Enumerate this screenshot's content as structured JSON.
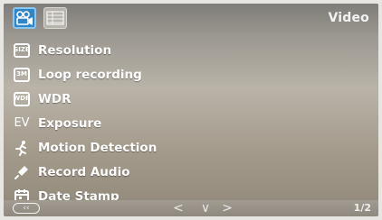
{
  "header": {
    "mode_label": "Video",
    "tabs": [
      {
        "name": "video-tab",
        "icon": "video-camera-icon",
        "active": true
      },
      {
        "name": "settings-tab",
        "icon": "menu-grid-icon",
        "active": false
      }
    ]
  },
  "menu": {
    "items": [
      {
        "label": "Resolution",
        "icon": "size-icon",
        "icon_text": "SIZE"
      },
      {
        "label": "Loop recording",
        "icon": "loop-icon",
        "icon_text": "3M"
      },
      {
        "label": "WDR",
        "icon": "wdr-icon",
        "icon_text": "WDR"
      },
      {
        "label": "Exposure",
        "icon": "ev-icon",
        "icon_text": "EV"
      },
      {
        "label": "Motion Detection",
        "icon": "running-man-icon"
      },
      {
        "label": "Record Audio",
        "icon": "microphone-icon"
      },
      {
        "label": "Date Stamp",
        "icon": "calendar-icon"
      }
    ]
  },
  "footer": {
    "back_label": "‹‹",
    "left_glyph": "<",
    "down_glyph": "∨",
    "right_glyph": ">",
    "page_indicator": "1/2"
  },
  "colors": {
    "active_tab": "#2f86c9",
    "text": "#ffffff"
  }
}
